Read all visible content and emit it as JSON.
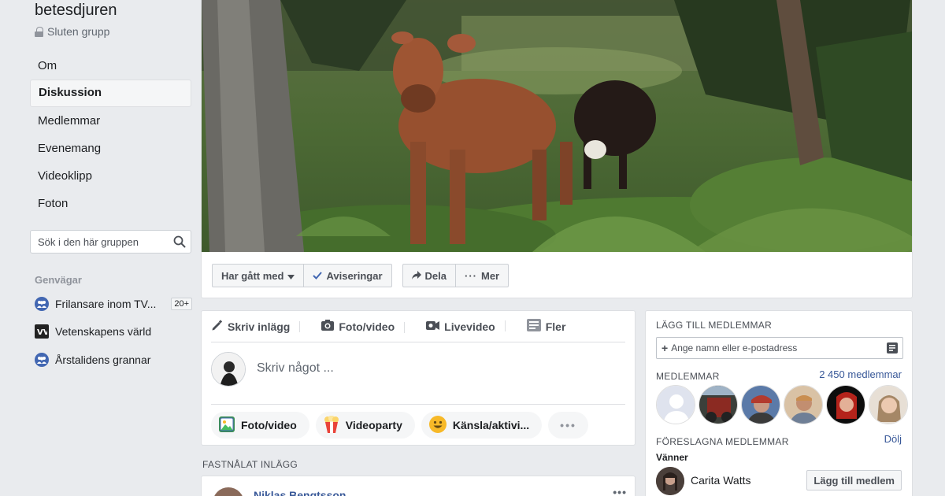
{
  "group": {
    "name": "betesdjuren",
    "type": "Sluten grupp"
  },
  "nav": {
    "items": [
      {
        "label": "Om"
      },
      {
        "label": "Diskussion"
      },
      {
        "label": "Medlemmar"
      },
      {
        "label": "Evenemang"
      },
      {
        "label": "Videoklipp"
      },
      {
        "label": "Foton"
      }
    ],
    "active": "Diskussion"
  },
  "search": {
    "placeholder": "Sök i den här gruppen",
    "icon": "search-icon"
  },
  "shortcuts": {
    "title": "Genvägar",
    "items": [
      {
        "label": "Frilansare inom TV...",
        "badge": "20+",
        "icon": "group-icon"
      },
      {
        "label": "Vetenskapens värld",
        "icon": "page-icon"
      },
      {
        "label": "Årstalidens grannar",
        "icon": "group-icon"
      }
    ]
  },
  "cover_actions": {
    "joined": "Har gått med",
    "notifications": "Aviseringar",
    "share": "Dela",
    "more": "Mer"
  },
  "composer": {
    "tabs": [
      {
        "label": "Skriv inlägg",
        "icon": "pencil-icon"
      },
      {
        "label": "Foto/video",
        "icon": "camera-icon"
      },
      {
        "label": "Livevideo",
        "icon": "video-icon"
      },
      {
        "label": "Fler",
        "icon": "more-grid-icon"
      }
    ],
    "placeholder": "Skriv något ...",
    "pills": [
      {
        "label": "Foto/video",
        "icon": "photo-icon"
      },
      {
        "label": "Videoparty",
        "icon": "popcorn-icon"
      },
      {
        "label": "Känsla/aktivi...",
        "icon": "smiley-icon"
      }
    ],
    "more_dots": "•••"
  },
  "pinned": {
    "title": "FASTNÅLAT INLÄGG",
    "author": "Niklas Bengtsson",
    "more": "•••"
  },
  "right": {
    "add_members_title": "LÄGG TILL MEDLEMMAR",
    "add_members_placeholder": "Ange namn eller e-postadress",
    "members_title": "MEDLEMMAR",
    "members_count": "2 450 medlemmar",
    "suggested_title": "FÖRESLAGNA MEDLEMMAR",
    "hide": "Dölj",
    "friends": "Vänner",
    "suggestion": {
      "name": "Carita Watts",
      "button": "Lägg till medlem"
    }
  },
  "colors": {
    "background": "#e9ebee",
    "link": "#385898",
    "brand": "#4267b2"
  }
}
